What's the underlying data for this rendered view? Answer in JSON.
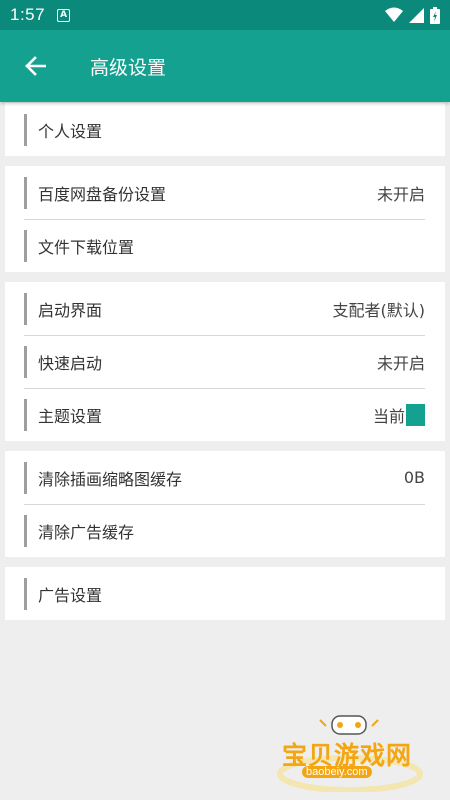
{
  "status": {
    "time": "1:57"
  },
  "header": {
    "title": "高级设置"
  },
  "groups": [
    [
      {
        "label": "个人设置",
        "value": ""
      }
    ],
    [
      {
        "label": "百度网盘备份设置",
        "value": "未开启"
      },
      {
        "label": "文件下载位置",
        "value": ""
      }
    ],
    [
      {
        "label": "启动界面",
        "value": "支配者(默认)"
      },
      {
        "label": "快速启动",
        "value": "未开启"
      },
      {
        "label": "主题设置",
        "value": "当前"
      }
    ],
    [
      {
        "label": "清除插画缩略图缓存",
        "value": "0B"
      },
      {
        "label": "清除广告缓存",
        "value": ""
      }
    ],
    [
      {
        "label": "广告设置",
        "value": ""
      }
    ]
  ],
  "colors": {
    "status_bar": "#0b8a7c",
    "app_bar": "#15a190",
    "theme_swatch": "#15a190",
    "watermark": "#f3a512"
  },
  "watermark": {
    "text": "宝贝游戏网",
    "url": "baobeiy.com"
  }
}
